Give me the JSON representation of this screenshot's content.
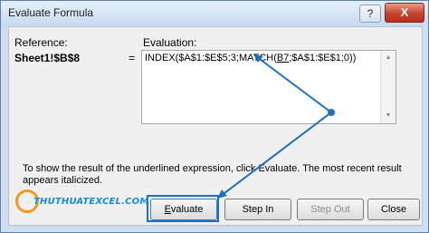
{
  "window": {
    "title": "Evaluate Formula"
  },
  "titlebar": {
    "help_label": "?",
    "close_label": "X"
  },
  "reference": {
    "label": "Reference:",
    "value": "Sheet1!$B$8",
    "equals": "="
  },
  "evaluation": {
    "label": "Evaluation:",
    "formula_before": "INDEX($A$1:$E$5;3;MATCH(",
    "formula_underlined": "B7",
    "formula_after": ";$A$1:$E$1;0))"
  },
  "help_text": "To show the result of the underlined expression, click Evaluate.  The most recent result appears italicized.",
  "buttons": {
    "evaluate_prefix": "",
    "evaluate_underlined": "E",
    "evaluate_rest": "valuate",
    "step_in": "Step In",
    "step_out": "Step Out",
    "close": "Close"
  },
  "watermark": {
    "text": "THUTHUATEXCEL.COM"
  },
  "colors": {
    "annotation": "#1c6fc6",
    "title_bar": "#c8dbf0",
    "close_button": "#c7432e"
  },
  "icons": {
    "scroll_up": "scroll-up-arrow-icon",
    "scroll_down": "scroll-down-arrow-icon",
    "logo": "logo-ring-icon"
  }
}
